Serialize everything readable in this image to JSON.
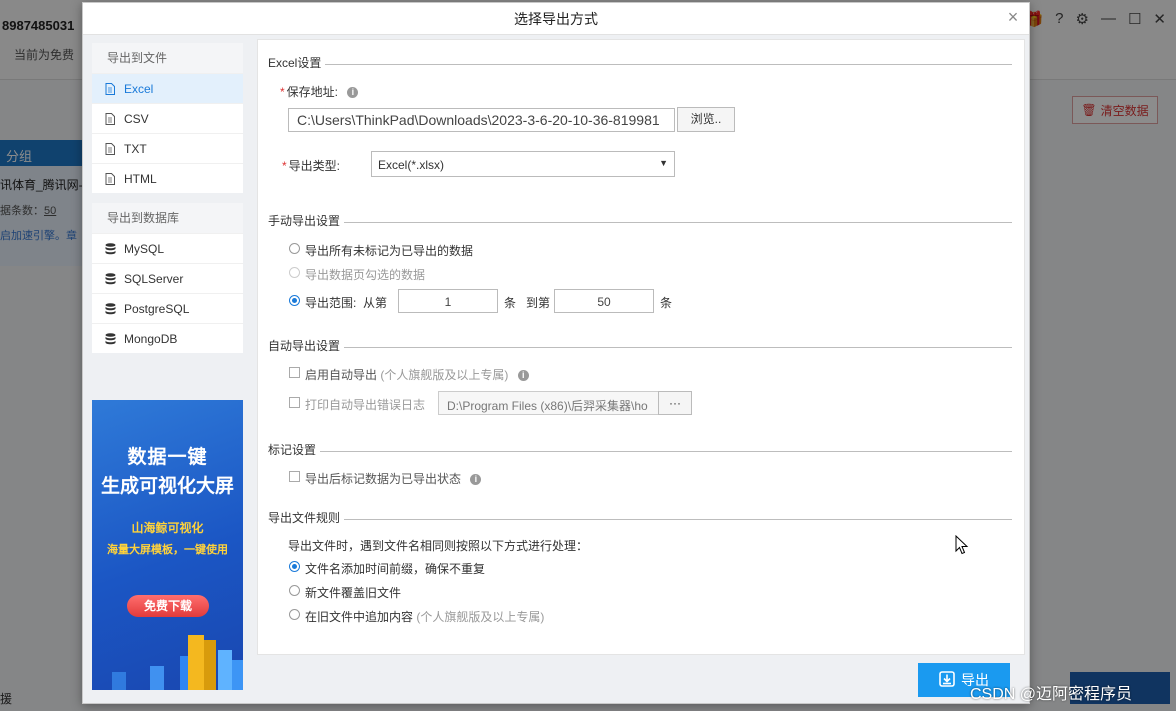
{
  "background": {
    "phone": "8987485031",
    "free_text": "当前为免费",
    "clear_button": "清空数据",
    "group_label": "分组",
    "item_title": "讯体育_腾讯网-",
    "item_count_label": "据条数：",
    "item_count": "50",
    "item_link": "启加速引擎。章",
    "bottom_left": "援"
  },
  "dialog": {
    "title": "选择导出方式",
    "close": "×"
  },
  "nav": {
    "file_group": {
      "label": "导出到文件",
      "items": [
        {
          "label": "Excel",
          "active": true
        },
        {
          "label": "CSV",
          "active": false
        },
        {
          "label": "TXT",
          "active": false
        },
        {
          "label": "HTML",
          "active": false
        }
      ]
    },
    "db_group": {
      "label": "导出到数据库",
      "items": [
        {
          "label": "MySQL"
        },
        {
          "label": "SQLServer"
        },
        {
          "label": "PostgreSQL"
        },
        {
          "label": "MongoDB"
        }
      ]
    }
  },
  "ad": {
    "line1": "数据一键",
    "line2": "生成可视化大屏",
    "line3": "山海鲸可视化",
    "line4": "海量大屏模板，一键使用",
    "button": "免费下载"
  },
  "excel": {
    "section": "Excel设置",
    "save_label": "保存地址:",
    "save_path": "C:\\Users\\ThinkPad\\Downloads\\2023-3-6-20-10-36-819981",
    "browse": "浏览..",
    "type_label": "导出类型:",
    "type_value": "Excel(*.xlsx)"
  },
  "manual": {
    "section": "手动导出设置",
    "opt_unmarked": "导出所有未标记为已导出的数据",
    "opt_selected": "导出数据页勾选的数据",
    "opt_range": "导出范围:",
    "from_label": "从第",
    "from_value": "1",
    "unit1": "条",
    "to_label": "到第",
    "to_value": "50",
    "unit2": "条"
  },
  "auto": {
    "section": "自动导出设置",
    "enable_label": "启用自动导出",
    "enable_note": "(个人旗舰版及以上专属)",
    "log_label": "打印自动导出错误日志",
    "log_path": "D:\\Program Files (x86)\\后羿采集器\\ho",
    "log_browse": "···"
  },
  "mark": {
    "section": "标记设置",
    "mark_label": "导出后标记数据为已导出状态"
  },
  "rules": {
    "section": "导出文件规则",
    "desc": "导出文件时，遇到文件名相同则按照以下方式进行处理：",
    "opt_timestamp": "文件名添加时间前缀，确保不重复",
    "opt_overwrite": "新文件覆盖旧文件",
    "opt_append": "在旧文件中追加内容",
    "append_note": "(个人旗舰版及以上专属)"
  },
  "footer": {
    "export_button": "导出",
    "watermark": "CSDN @迈阿密程序员"
  }
}
